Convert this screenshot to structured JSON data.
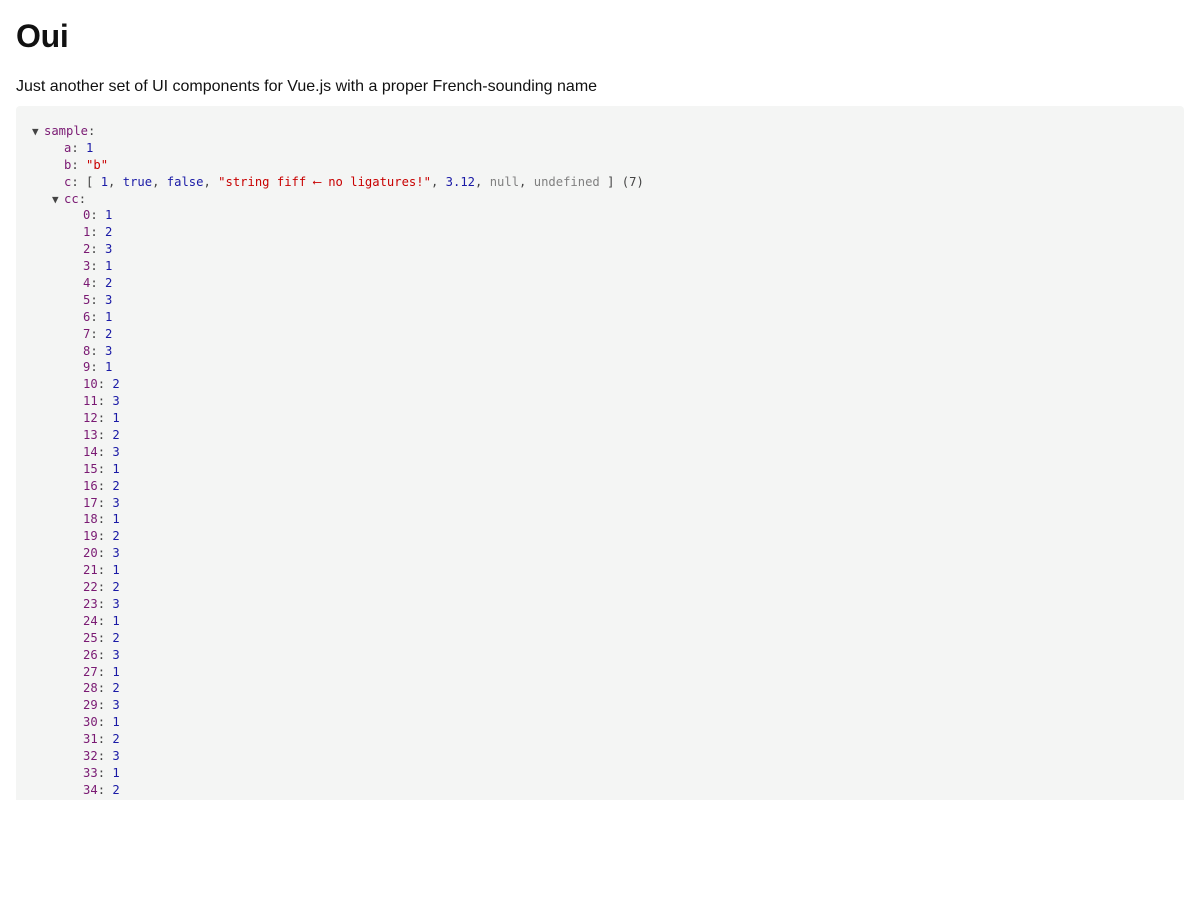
{
  "header": {
    "title": "Oui",
    "subtitle": "Just another set of UI components for Vue.js with a proper French-sounding name"
  },
  "tree": {
    "toggle_glyph": "▼",
    "root_key": "sample",
    "a": {
      "key": "a",
      "value": "1"
    },
    "b": {
      "key": "b",
      "value": "\"b\""
    },
    "c": {
      "key": "c",
      "items": [
        {
          "value": "1",
          "kind": "num"
        },
        {
          "value": "true",
          "kind": "bool"
        },
        {
          "value": "false",
          "kind": "bool"
        },
        {
          "value": "\"string fiff ⟵ no ligatures!\"",
          "kind": "str"
        },
        {
          "value": "3.12",
          "kind": "num"
        },
        {
          "value": "null",
          "kind": "nil"
        },
        {
          "value": "undefined",
          "kind": "nil"
        }
      ],
      "count_label": "(7)"
    },
    "cc": {
      "key": "cc",
      "entries": [
        {
          "index": "0",
          "value": "1"
        },
        {
          "index": "1",
          "value": "2"
        },
        {
          "index": "2",
          "value": "3"
        },
        {
          "index": "3",
          "value": "1"
        },
        {
          "index": "4",
          "value": "2"
        },
        {
          "index": "5",
          "value": "3"
        },
        {
          "index": "6",
          "value": "1"
        },
        {
          "index": "7",
          "value": "2"
        },
        {
          "index": "8",
          "value": "3"
        },
        {
          "index": "9",
          "value": "1"
        },
        {
          "index": "10",
          "value": "2"
        },
        {
          "index": "11",
          "value": "3"
        },
        {
          "index": "12",
          "value": "1"
        },
        {
          "index": "13",
          "value": "2"
        },
        {
          "index": "14",
          "value": "3"
        },
        {
          "index": "15",
          "value": "1"
        },
        {
          "index": "16",
          "value": "2"
        },
        {
          "index": "17",
          "value": "3"
        },
        {
          "index": "18",
          "value": "1"
        },
        {
          "index": "19",
          "value": "2"
        },
        {
          "index": "20",
          "value": "3"
        },
        {
          "index": "21",
          "value": "1"
        },
        {
          "index": "22",
          "value": "2"
        },
        {
          "index": "23",
          "value": "3"
        },
        {
          "index": "24",
          "value": "1"
        },
        {
          "index": "25",
          "value": "2"
        },
        {
          "index": "26",
          "value": "3"
        },
        {
          "index": "27",
          "value": "1"
        },
        {
          "index": "28",
          "value": "2"
        },
        {
          "index": "29",
          "value": "3"
        },
        {
          "index": "30",
          "value": "1"
        },
        {
          "index": "31",
          "value": "2"
        },
        {
          "index": "32",
          "value": "3"
        },
        {
          "index": "33",
          "value": "1"
        },
        {
          "index": "34",
          "value": "2"
        }
      ]
    }
  }
}
